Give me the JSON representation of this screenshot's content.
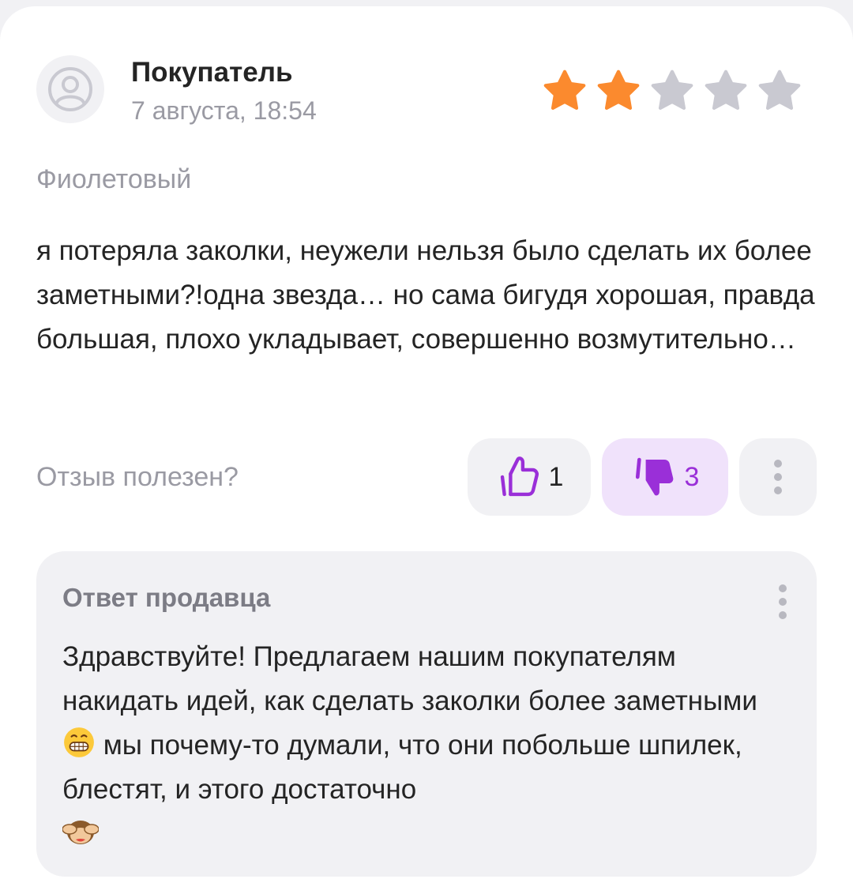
{
  "review": {
    "author": "Покупатель",
    "date": "7 августа, 18:54",
    "rating": 2,
    "max_rating": 5,
    "variant": "Фиолетовый",
    "text": "я потеряла заколки, неужели нельзя было сделать их более заметными?!одна звезда… но сама бигудя хорошая, правда большая, плохо укладывает, совершенно возмутительно…"
  },
  "helpful": {
    "label": "Отзыв полезен?",
    "likes": "1",
    "dislikes": "3"
  },
  "seller_reply": {
    "title": "Ответ продавца",
    "text_part1": "Здравствуйте! Предлагаем нашим покупателям накидать идей, как сделать заколки более заметными",
    "text_part2": "мы почему-то думали, что они побольше шпилек, блестят, и этого достаточно"
  },
  "colors": {
    "star_filled": "#fb8a2e",
    "star_empty": "#c9c9d1",
    "accent_purple": "#9a2fd8",
    "dislike_bg": "#f0e2fb",
    "muted_text": "#9a9aa3"
  },
  "icons": {
    "avatar": "user-icon",
    "like": "thumbs-up-icon",
    "dislike": "thumbs-down-icon",
    "more": "more-vertical-icon",
    "emoji_grin": "grinning-face-emoji",
    "emoji_monkey": "see-no-evil-monkey-emoji"
  }
}
